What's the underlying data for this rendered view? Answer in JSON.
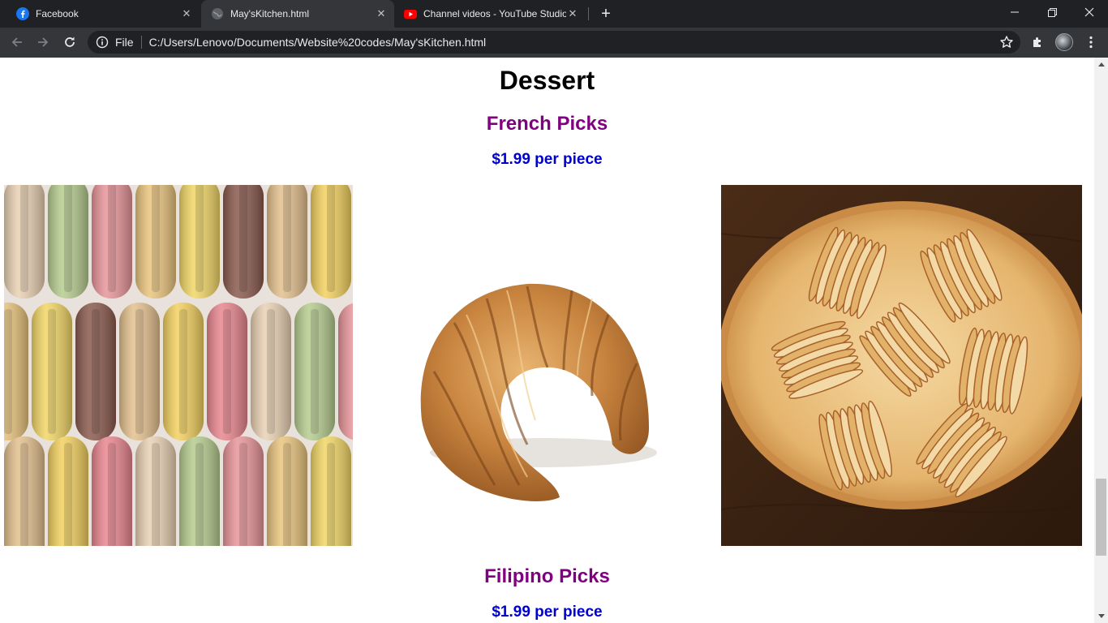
{
  "browser": {
    "tabs": [
      {
        "title": "Facebook",
        "icon": "facebook-icon",
        "active": false
      },
      {
        "title": "May'sKitchen.html",
        "icon": "globe-icon",
        "active": true
      },
      {
        "title": "Channel videos - YouTube Studio",
        "icon": "youtube-icon",
        "active": false
      }
    ],
    "scheme_label": "File",
    "url": "C:/Users/Lenovo/Documents/Website%20codes/May'sKitchen.html",
    "colors": {
      "tabstrip": "#202124",
      "toolbar": "#35363a",
      "omnibox": "#202124"
    }
  },
  "page": {
    "heading": "Dessert",
    "sections": [
      {
        "title": "French Picks",
        "price": "$1.99 per piece"
      },
      {
        "title": "Filipino Picks",
        "price": "$1.99 per piece"
      }
    ],
    "images": [
      {
        "name": "macarons-image",
        "subject": "rows of colorful French macarons"
      },
      {
        "name": "croissant-image",
        "subject": "golden croissant on white background"
      },
      {
        "name": "apple-tart-image",
        "subject": "French apple tart with fanned apple slices"
      }
    ],
    "colors": {
      "section_title": "#800080",
      "price": "#0000cd",
      "heading": "#000000"
    }
  }
}
